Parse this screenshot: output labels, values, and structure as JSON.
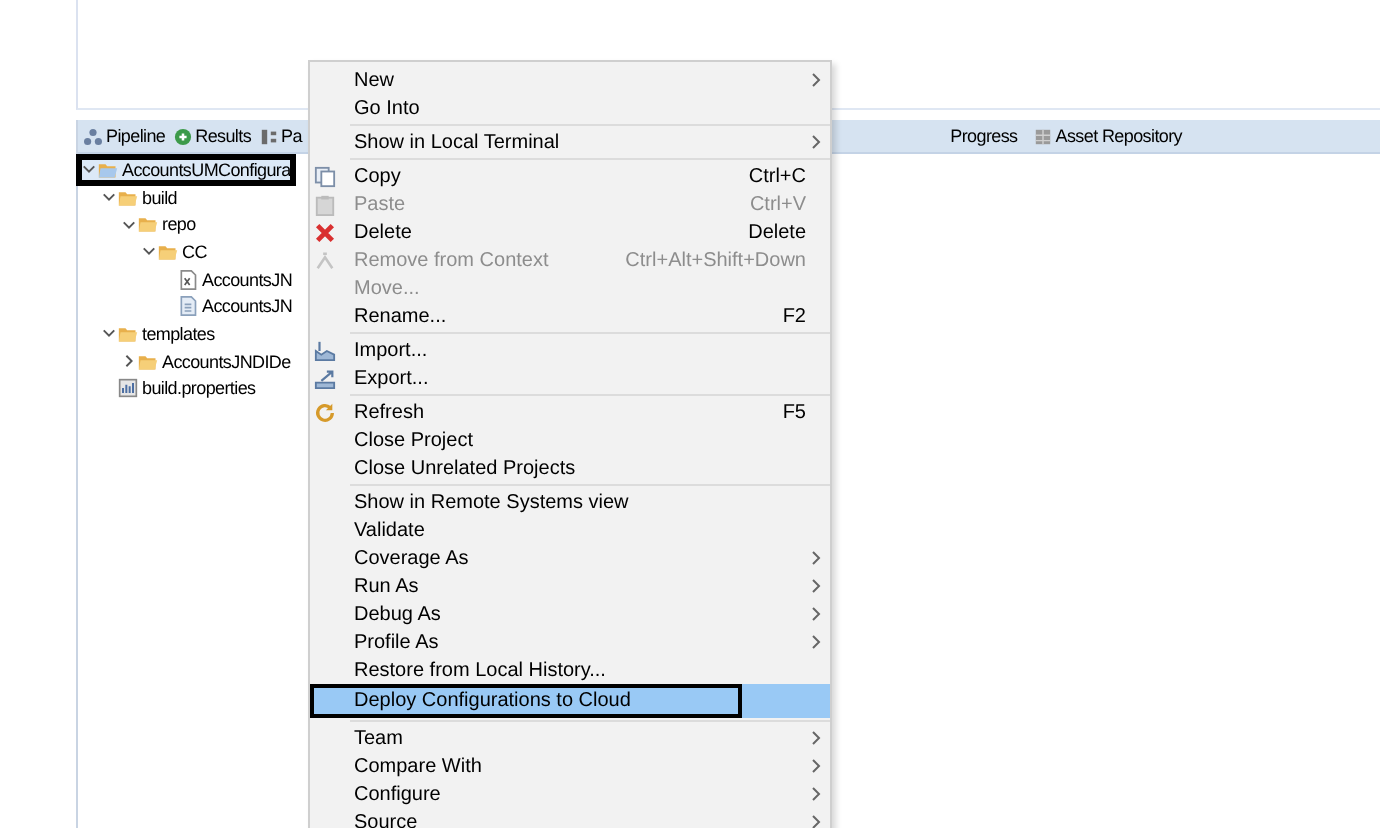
{
  "tabs": [
    {
      "label": "Pipeline",
      "selected": false
    },
    {
      "label": "Results",
      "selected": false
    },
    {
      "label": "Pa",
      "selected": false
    },
    {
      "label": "Progress",
      "selected": false
    },
    {
      "label": "Asset Repository",
      "selected": false
    }
  ],
  "tree": [
    {
      "label": "AccountsUMConfigura",
      "kind": "folder",
      "expanded": true,
      "annotated": true,
      "children": [
        {
          "label": "build",
          "kind": "folder",
          "expanded": true,
          "annotated": false,
          "children": [
            {
              "label": "repo",
              "kind": "folder",
              "expanded": true,
              "annotated": false,
              "children": [
                {
                  "label": "CC",
                  "kind": "folder",
                  "expanded": true,
                  "annotated": false,
                  "children": [
                    {
                      "label": "AccountsJN",
                      "kind": "xml",
                      "annotated": false
                    },
                    {
                      "label": "AccountsJN",
                      "kind": "file",
                      "annotated": false
                    }
                  ]
                }
              ]
            }
          ]
        },
        {
          "label": "templates",
          "kind": "folder",
          "expanded": true,
          "annotated": false,
          "children": [
            {
              "label": "AccountsJNDIDe",
              "kind": "folder",
              "expanded": false,
              "annotated": false
            }
          ]
        },
        {
          "label": "build.properties",
          "kind": "props",
          "annotated": false
        }
      ]
    }
  ],
  "menu": [
    [
      {
        "label": "New",
        "submenu": true,
        "disabled": false,
        "selected": false
      },
      {
        "label": "Go Into",
        "submenu": false,
        "disabled": false,
        "selected": false
      }
    ],
    [
      {
        "label": "Show in Local Terminal",
        "submenu": true,
        "disabled": false,
        "selected": false
      }
    ],
    [
      {
        "label": "Copy",
        "shortcut": "Ctrl+C",
        "submenu": false,
        "disabled": false,
        "selected": false
      },
      {
        "label": "Paste",
        "shortcut": "Ctrl+V",
        "submenu": false,
        "disabled": true,
        "selected": false
      },
      {
        "label": "Delete",
        "shortcut": "Delete",
        "submenu": false,
        "disabled": false,
        "selected": false
      },
      {
        "label": "Remove from Context",
        "shortcut": "Ctrl+Alt+Shift+Down",
        "submenu": false,
        "disabled": true,
        "selected": false
      },
      {
        "label": "Move...",
        "submenu": false,
        "disabled": true,
        "selected": false
      },
      {
        "label": "Rename...",
        "shortcut": "F2",
        "submenu": false,
        "disabled": false,
        "selected": false
      }
    ],
    [
      {
        "label": "Import...",
        "submenu": false,
        "disabled": false,
        "selected": false
      },
      {
        "label": "Export...",
        "submenu": false,
        "disabled": false,
        "selected": false
      }
    ],
    [
      {
        "label": "Refresh",
        "shortcut": "F5",
        "submenu": false,
        "disabled": false,
        "selected": false
      },
      {
        "label": "Close Project",
        "submenu": false,
        "disabled": false,
        "selected": false
      },
      {
        "label": "Close Unrelated Projects",
        "submenu": false,
        "disabled": false,
        "selected": false
      }
    ],
    [
      {
        "label": "Show in Remote Systems view",
        "submenu": false,
        "disabled": false,
        "selected": false
      },
      {
        "label": "Validate",
        "submenu": false,
        "disabled": false,
        "selected": false
      },
      {
        "label": "Coverage As",
        "submenu": true,
        "disabled": false,
        "selected": false
      },
      {
        "label": "Run As",
        "submenu": true,
        "disabled": false,
        "selected": false
      },
      {
        "label": "Debug As",
        "submenu": true,
        "disabled": false,
        "selected": false
      },
      {
        "label": "Profile As",
        "submenu": true,
        "disabled": false,
        "selected": false
      },
      {
        "label": "Restore from Local History...",
        "submenu": false,
        "disabled": false,
        "selected": false
      },
      {
        "label": "Deploy Configurations to Cloud",
        "submenu": false,
        "disabled": false,
        "selected": true,
        "annotated": true
      }
    ],
    [
      {
        "label": "Team",
        "submenu": true,
        "disabled": false,
        "selected": false
      },
      {
        "label": "Compare With",
        "submenu": true,
        "disabled": false,
        "selected": false
      },
      {
        "label": "Configure",
        "submenu": true,
        "disabled": false,
        "selected": false
      },
      {
        "label": "Source",
        "submenu": true,
        "disabled": false,
        "selected": false
      }
    ]
  ]
}
